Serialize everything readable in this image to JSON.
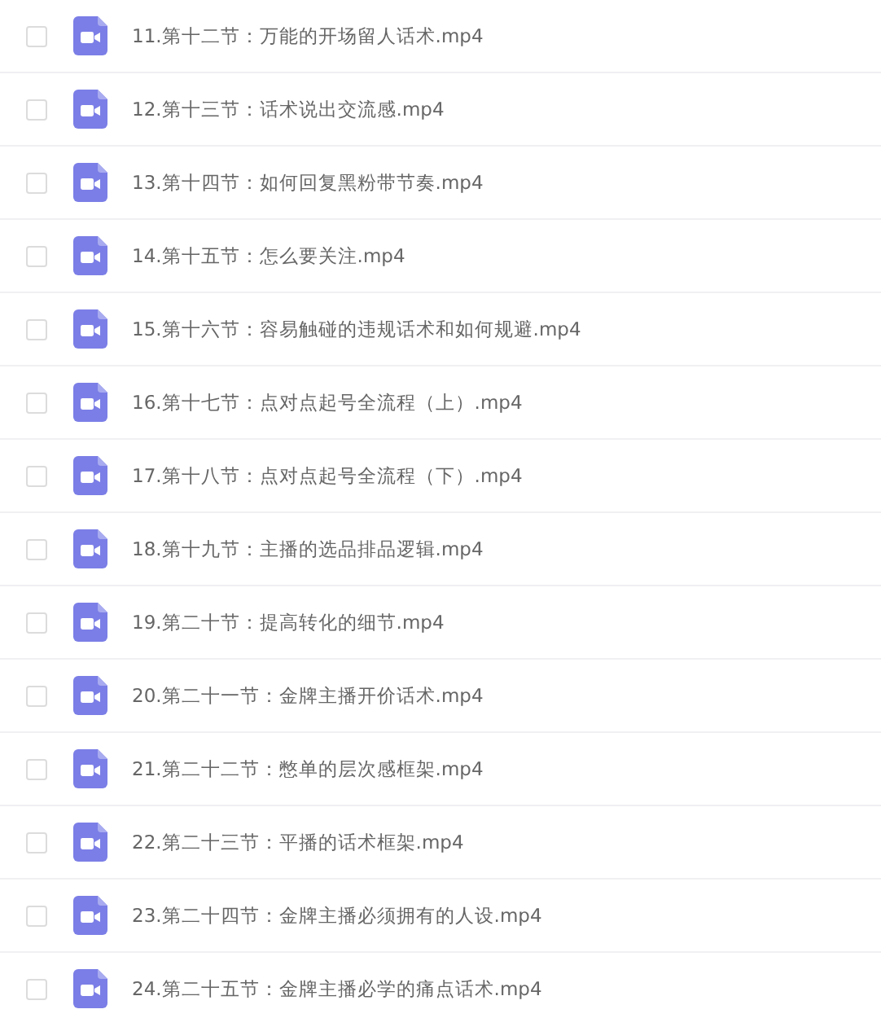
{
  "files": [
    {
      "name": "11.第十二节：万能的开场留人话术.mp4",
      "checked": false
    },
    {
      "name": "12.第十三节：话术说出交流感.mp4",
      "checked": false
    },
    {
      "name": "13.第十四节：如何回复黑粉带节奏.mp4",
      "checked": false
    },
    {
      "name": "14.第十五节：怎么要关注.mp4",
      "checked": false
    },
    {
      "name": "15.第十六节：容易触碰的违规话术和如何规避.mp4",
      "checked": false
    },
    {
      "name": "16.第十七节：点对点起号全流程（上）.mp4",
      "checked": false
    },
    {
      "name": "17.第十八节：点对点起号全流程（下）.mp4",
      "checked": false
    },
    {
      "name": "18.第十九节：主播的选品排品逻辑.mp4",
      "checked": false
    },
    {
      "name": "19.第二十节：提高转化的细节.mp4",
      "checked": false
    },
    {
      "name": "20.第二十一节：金牌主播开价话术.mp4",
      "checked": false
    },
    {
      "name": "21.第二十二节：憋单的层次感框架.mp4",
      "checked": false
    },
    {
      "name": "22.第二十三节：平播的话术框架.mp4",
      "checked": false
    },
    {
      "name": "23.第二十四节：金牌主播必须拥有的人设.mp4",
      "checked": false
    },
    {
      "name": "24.第二十五节：金牌主播必学的痛点话术.mp4",
      "checked": false
    }
  ]
}
